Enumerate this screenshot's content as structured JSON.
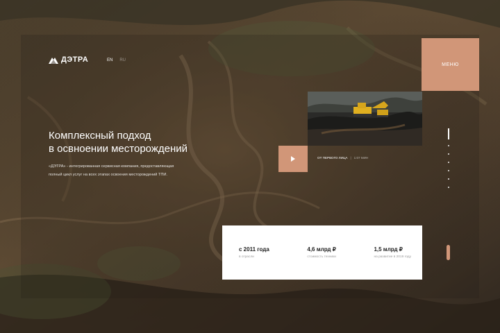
{
  "brand": {
    "name": "ДЭТРА"
  },
  "lang": {
    "active": "EN",
    "inactive": "RU"
  },
  "menu": {
    "label": "МЕНЮ"
  },
  "hero": {
    "title_lines": [
      "Комплексный подход",
      "в освноении месторождений"
    ],
    "description": "«ДЭТРА» - интегрированная сервисная компания, предоставляющая полный цикл услуг на всех этапах освоения месторождений ТПИ."
  },
  "video": {
    "label": "ОТ ПЕРВОГО ЛИЦА",
    "separator": "|",
    "duration": "1:07 МИН"
  },
  "stats": [
    {
      "value": "с 2011 года",
      "label": "в отрасли"
    },
    {
      "value": "4,6 млрд ₽",
      "label": "стоимость техники"
    },
    {
      "value": "1,5 млрд ₽",
      "label": "на развитие в 2019 году"
    }
  ],
  "colors": {
    "accent": "#d19678",
    "background": "#3a3026",
    "panel": "#ffffff"
  },
  "icons": {
    "logo": "mountain-logo-icon",
    "play": "play-icon"
  }
}
